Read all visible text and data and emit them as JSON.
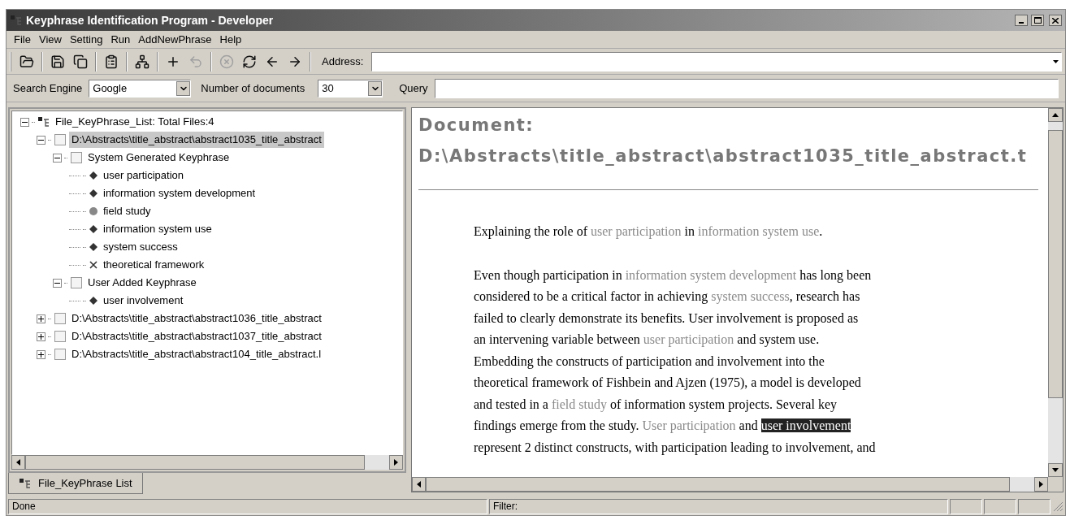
{
  "window": {
    "title": "Keyphrase Identification Program - Developer"
  },
  "menu": [
    "File",
    "View",
    "Setting",
    "Run",
    "AddNewPhrase",
    "Help"
  ],
  "toolbar": [
    {
      "kind": "open",
      "disabled": false
    },
    {
      "kind": "sep"
    },
    {
      "kind": "save",
      "disabled": false
    },
    {
      "kind": "saveall",
      "disabled": false
    },
    {
      "kind": "sep"
    },
    {
      "kind": "properties",
      "disabled": false
    },
    {
      "kind": "sep"
    },
    {
      "kind": "tree",
      "disabled": false
    },
    {
      "kind": "sep"
    },
    {
      "kind": "add",
      "disabled": false
    },
    {
      "kind": "undo",
      "disabled": true
    },
    {
      "kind": "sep"
    },
    {
      "kind": "stop",
      "disabled": true
    },
    {
      "kind": "refresh",
      "disabled": false
    },
    {
      "kind": "back",
      "disabled": false
    },
    {
      "kind": "forward",
      "disabled": false
    },
    {
      "kind": "sep"
    }
  ],
  "address": {
    "label": "Address:"
  },
  "search": {
    "engine_label": "Search Engine",
    "engine": "Google",
    "count_label": "Number of documents",
    "count": "30",
    "query_label": "Query"
  },
  "tree": [
    {
      "kind": "root",
      "label": "File_KeyPhrase_List: Total Files:4",
      "expanded": true,
      "selected": false,
      "children": [
        {
          "kind": "file",
          "label": "D:\\Abstracts\\title_abstract\\abstract1035_title_abstract",
          "expanded": true,
          "selected": true,
          "children": [
            {
              "kind": "group",
              "label": "System Generated Keyphrase",
              "expanded": true,
              "selected": false,
              "children": [
                {
                  "kind": "diamond",
                  "label": "user participation",
                  "selected": false
                },
                {
                  "kind": "diamond",
                  "label": "information system development",
                  "selected": false
                },
                {
                  "kind": "circle",
                  "label": "field study",
                  "selected": false
                },
                {
                  "kind": "diamond",
                  "label": "information system use",
                  "selected": false
                },
                {
                  "kind": "diamond",
                  "label": "system success",
                  "selected": false
                },
                {
                  "kind": "cross",
                  "label": "theoretical framework",
                  "selected": false
                }
              ]
            },
            {
              "kind": "group",
              "label": "User Added Keyphrase",
              "expanded": true,
              "selected": false,
              "children": [
                {
                  "kind": "diamond",
                  "label": "user involvement",
                  "selected": false
                }
              ]
            }
          ]
        },
        {
          "kind": "file",
          "label": "D:\\Abstracts\\title_abstract\\abstract1036_title_abstract",
          "expanded": false,
          "selected": false
        },
        {
          "kind": "file",
          "label": "D:\\Abstracts\\title_abstract\\abstract1037_title_abstract",
          "expanded": false,
          "selected": false
        },
        {
          "kind": "file",
          "label": "D:\\Abstracts\\title_abstract\\abstract104_title_abstract.l",
          "expanded": false,
          "selected": false
        }
      ]
    }
  ],
  "left_tab": {
    "label": "File_KeyPhrase List",
    "selected": true
  },
  "document": {
    "heading": [
      "Document:",
      "D:\\Abstracts\\title_abstract\\abstract1035_title_abstract.t"
    ],
    "paragraphs": [
      [
        [
          {
            "kind": "plain",
            "text": "Explaining the role of "
          },
          {
            "kind": "keyphrase",
            "text": "user participation"
          },
          {
            "kind": "plain",
            "text": " in "
          },
          {
            "kind": "keyphrase",
            "text": "information system use"
          },
          {
            "kind": "plain",
            "text": "."
          }
        ]
      ],
      [
        [
          {
            "kind": "plain",
            "text": "Even though participation in "
          },
          {
            "kind": "keyphrase",
            "text": "information system development"
          },
          {
            "kind": "plain",
            "text": " has long been"
          }
        ],
        [
          {
            "kind": "plain",
            "text": "considered to be a critical factor in achieving "
          },
          {
            "kind": "keyphrase",
            "text": "system success"
          },
          {
            "kind": "plain",
            "text": ", research has"
          }
        ],
        [
          {
            "kind": "plain",
            "text": "failed to clearly demonstrate its benefits. User involvement is proposed as"
          }
        ],
        [
          {
            "kind": "plain",
            "text": "an intervening variable between "
          },
          {
            "kind": "keyphrase",
            "text": "user participation"
          },
          {
            "kind": "plain",
            "text": " and system use."
          }
        ],
        [
          {
            "kind": "plain",
            "text": "Embedding the constructs of participation and involvement into the"
          }
        ],
        [
          {
            "kind": "plain",
            "text": "theoretical framework of Fishbein and Ajzen (1975), a model is developed"
          }
        ],
        [
          {
            "kind": "plain",
            "text": "and tested in a "
          },
          {
            "kind": "keyphrase",
            "text": "field study"
          },
          {
            "kind": "plain",
            "text": " of information system projects. Several key"
          }
        ],
        [
          {
            "kind": "plain",
            "text": "findings emerge from the study. "
          },
          {
            "kind": "keyphrase",
            "text": "User participation"
          },
          {
            "kind": "plain",
            "text": " and "
          },
          {
            "kind": "highlight",
            "text": "user involvement"
          }
        ],
        [
          {
            "kind": "plain",
            "text": "represent 2 distinct constructs, with participation leading to involvement, and"
          }
        ]
      ]
    ]
  },
  "status_bar": {
    "left": "Done",
    "filter": "Filter:"
  }
}
